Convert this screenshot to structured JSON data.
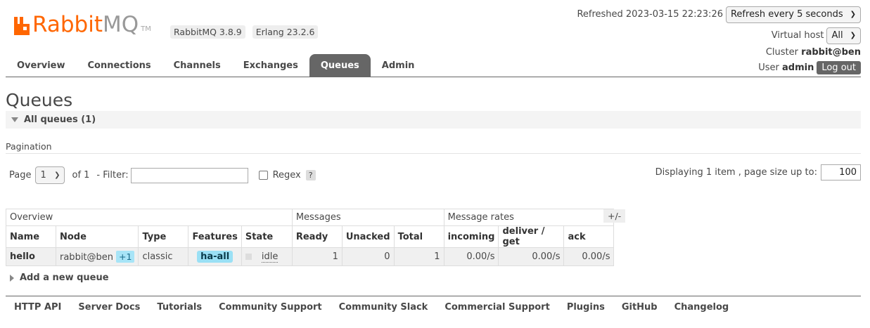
{
  "header": {
    "logo_rabbit": "Rabbit",
    "logo_mq": "MQ",
    "logo_tm": "TM",
    "rabbitmq_version": "RabbitMQ 3.8.9",
    "erlang_version": "Erlang 23.2.6",
    "refreshed_label": "Refreshed 2023-03-15 22:23:26",
    "refresh_option": "Refresh every 5 seconds",
    "vhost_label": "Virtual host",
    "vhost_value": "All",
    "cluster_label": "Cluster",
    "cluster_value": "rabbit@ben",
    "user_label": "User",
    "user_value": "admin",
    "logout_label": "Log out",
    "brand_color": "#ff6600"
  },
  "tabs": [
    "Overview",
    "Connections",
    "Channels",
    "Exchanges",
    "Queues",
    "Admin"
  ],
  "active_tab": "Queues",
  "page": {
    "title": "Queues",
    "section_title": "All queues (1)",
    "pagination_label": "Pagination",
    "page_label": "Page",
    "page_value": "1",
    "of_label": "of 1",
    "filter_label": "- Filter:",
    "filter_value": "",
    "regex_label": "Regex",
    "help_label": "?",
    "displaying_label": "Displaying 1 item , page size up to:",
    "page_size": "100"
  },
  "table": {
    "groups": [
      "Overview",
      "Messages",
      "Message rates"
    ],
    "columns": [
      "Name",
      "Node",
      "Type",
      "Features",
      "State",
      "Ready",
      "Unacked",
      "Total",
      "incoming",
      "deliver / get",
      "ack"
    ],
    "plusminus": "+/-",
    "rows": [
      {
        "name": "hello",
        "node": "rabbit@ben",
        "node_extra": "+1",
        "type": "classic",
        "feature": "ha-all",
        "state": "idle",
        "ready": "1",
        "unacked": "0",
        "total": "1",
        "incoming": "0.00/s",
        "deliver_get": "0.00/s",
        "ack": "0.00/s"
      }
    ]
  },
  "add_queue_label": "Add a new queue",
  "footer": [
    "HTTP API",
    "Server Docs",
    "Tutorials",
    "Community Support",
    "Community Slack",
    "Commercial Support",
    "Plugins",
    "GitHub",
    "Changelog"
  ]
}
